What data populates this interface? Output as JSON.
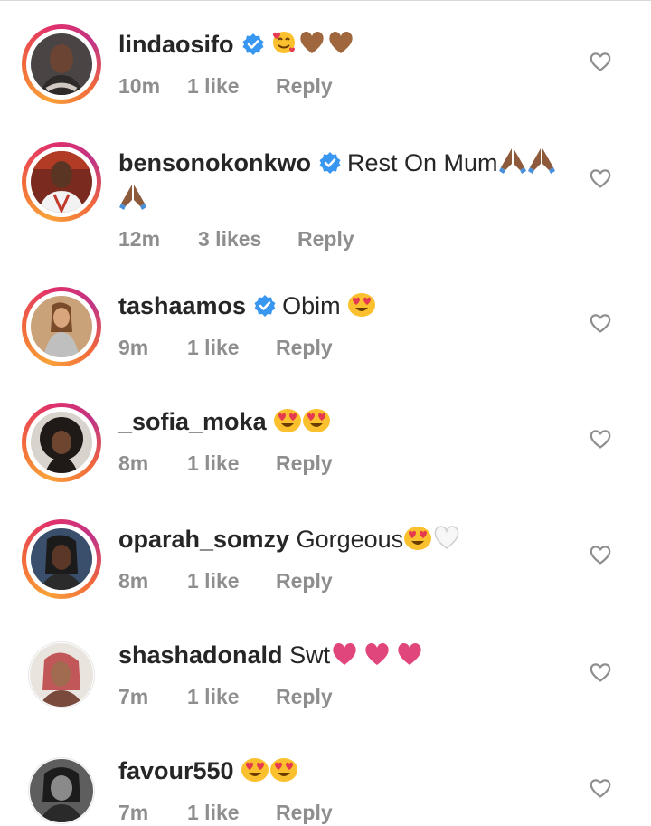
{
  "comments": [
    {
      "username": "lindaosifo",
      "verified": true,
      "text": "",
      "emojis": [
        "smiling-hearts-emoji",
        "brown-heart-emoji",
        "brown-heart-emoji"
      ],
      "time": "10m",
      "likes": "1 like",
      "reply": "Reply",
      "ring": true
    },
    {
      "username": "bensonokonkwo",
      "verified": true,
      "text": "Rest On Mum",
      "emojis": [
        "folded-hands-emoji",
        "folded-hands-emoji",
        "folded-hands-emoji"
      ],
      "time": "12m",
      "likes": "3 likes",
      "reply": "Reply",
      "ring": true
    },
    {
      "username": "tashaamos",
      "verified": true,
      "text": "Obim",
      "emojis": [
        "heart-eyes-emoji"
      ],
      "time": "9m",
      "likes": "1 like",
      "reply": "Reply",
      "ring": true
    },
    {
      "username": "_sofia_moka",
      "verified": false,
      "text": "",
      "emojis": [
        "heart-eyes-emoji",
        "heart-eyes-emoji"
      ],
      "time": "8m",
      "likes": "1 like",
      "reply": "Reply",
      "ring": true
    },
    {
      "username": "oparah_somzy",
      "verified": false,
      "text": "Gorgeous",
      "emojis": [
        "heart-eyes-emoji",
        "white-heart-emoji"
      ],
      "time": "8m",
      "likes": "1 like",
      "reply": "Reply",
      "ring": true
    },
    {
      "username": "shashadonald",
      "verified": false,
      "text": "Swt",
      "emojis": [
        "pink-heart-emoji",
        "pink-heart-emoji",
        "pink-heart-emoji"
      ],
      "time": "7m",
      "likes": "1 like",
      "reply": "Reply",
      "ring": false
    },
    {
      "username": "favour550",
      "verified": false,
      "text": "",
      "emojis": [
        "heart-eyes-emoji",
        "heart-eyes-emoji"
      ],
      "time": "7m",
      "likes": "1 like",
      "reply": "Reply",
      "ring": false
    }
  ],
  "colors": {
    "verified_blue": "#3897f0",
    "meta_gray": "#8e8e8e",
    "text": "#262626",
    "pink_heart": "#e0457b",
    "brown_heart": "#a0663d"
  }
}
